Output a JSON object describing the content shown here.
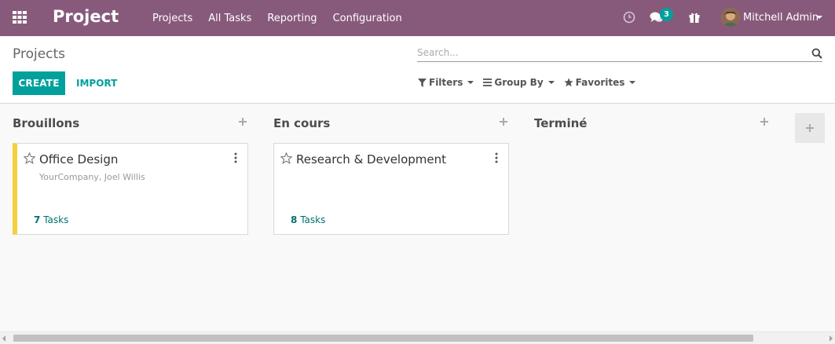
{
  "navbar": {
    "brand": "Project",
    "menu": [
      "Projects",
      "All Tasks",
      "Reporting",
      "Configuration"
    ],
    "chat_count": "3",
    "user_name": "Mitchell Admin",
    "bg_color": "#875a7b"
  },
  "control_panel": {
    "breadcrumb": "Projects",
    "create_label": "CREATE",
    "import_label": "IMPORT",
    "search_placeholder": "Search...",
    "filters_label": "Filters",
    "group_by_label": "Group By",
    "favorites_label": "Favorites"
  },
  "kanban": {
    "columns": [
      {
        "title": "Brouillons",
        "cards": [
          {
            "title": "Office Design",
            "subtitle": "YourCompany, Joel Willis",
            "task_count": "7",
            "task_label": "Tasks",
            "color": "#f4d03f"
          }
        ]
      },
      {
        "title": "En cours",
        "cards": [
          {
            "title": "Research & Development",
            "subtitle": "",
            "task_count": "8",
            "task_label": "Tasks"
          }
        ]
      },
      {
        "title": "Terminé",
        "cards": []
      }
    ]
  },
  "icons": {
    "apps": "apps-grid-icon",
    "clock": "clock-icon",
    "chat": "chat-icon",
    "gift": "gift-icon",
    "search": "search-icon",
    "filter": "filter-icon",
    "group_by": "bars-icon",
    "favorites": "star-icon",
    "add": "plus-icon",
    "card_menu": "kebab-icon"
  },
  "colors": {
    "primary": "#00a09d",
    "brand": "#875a7b",
    "task_link": "#00716e"
  }
}
